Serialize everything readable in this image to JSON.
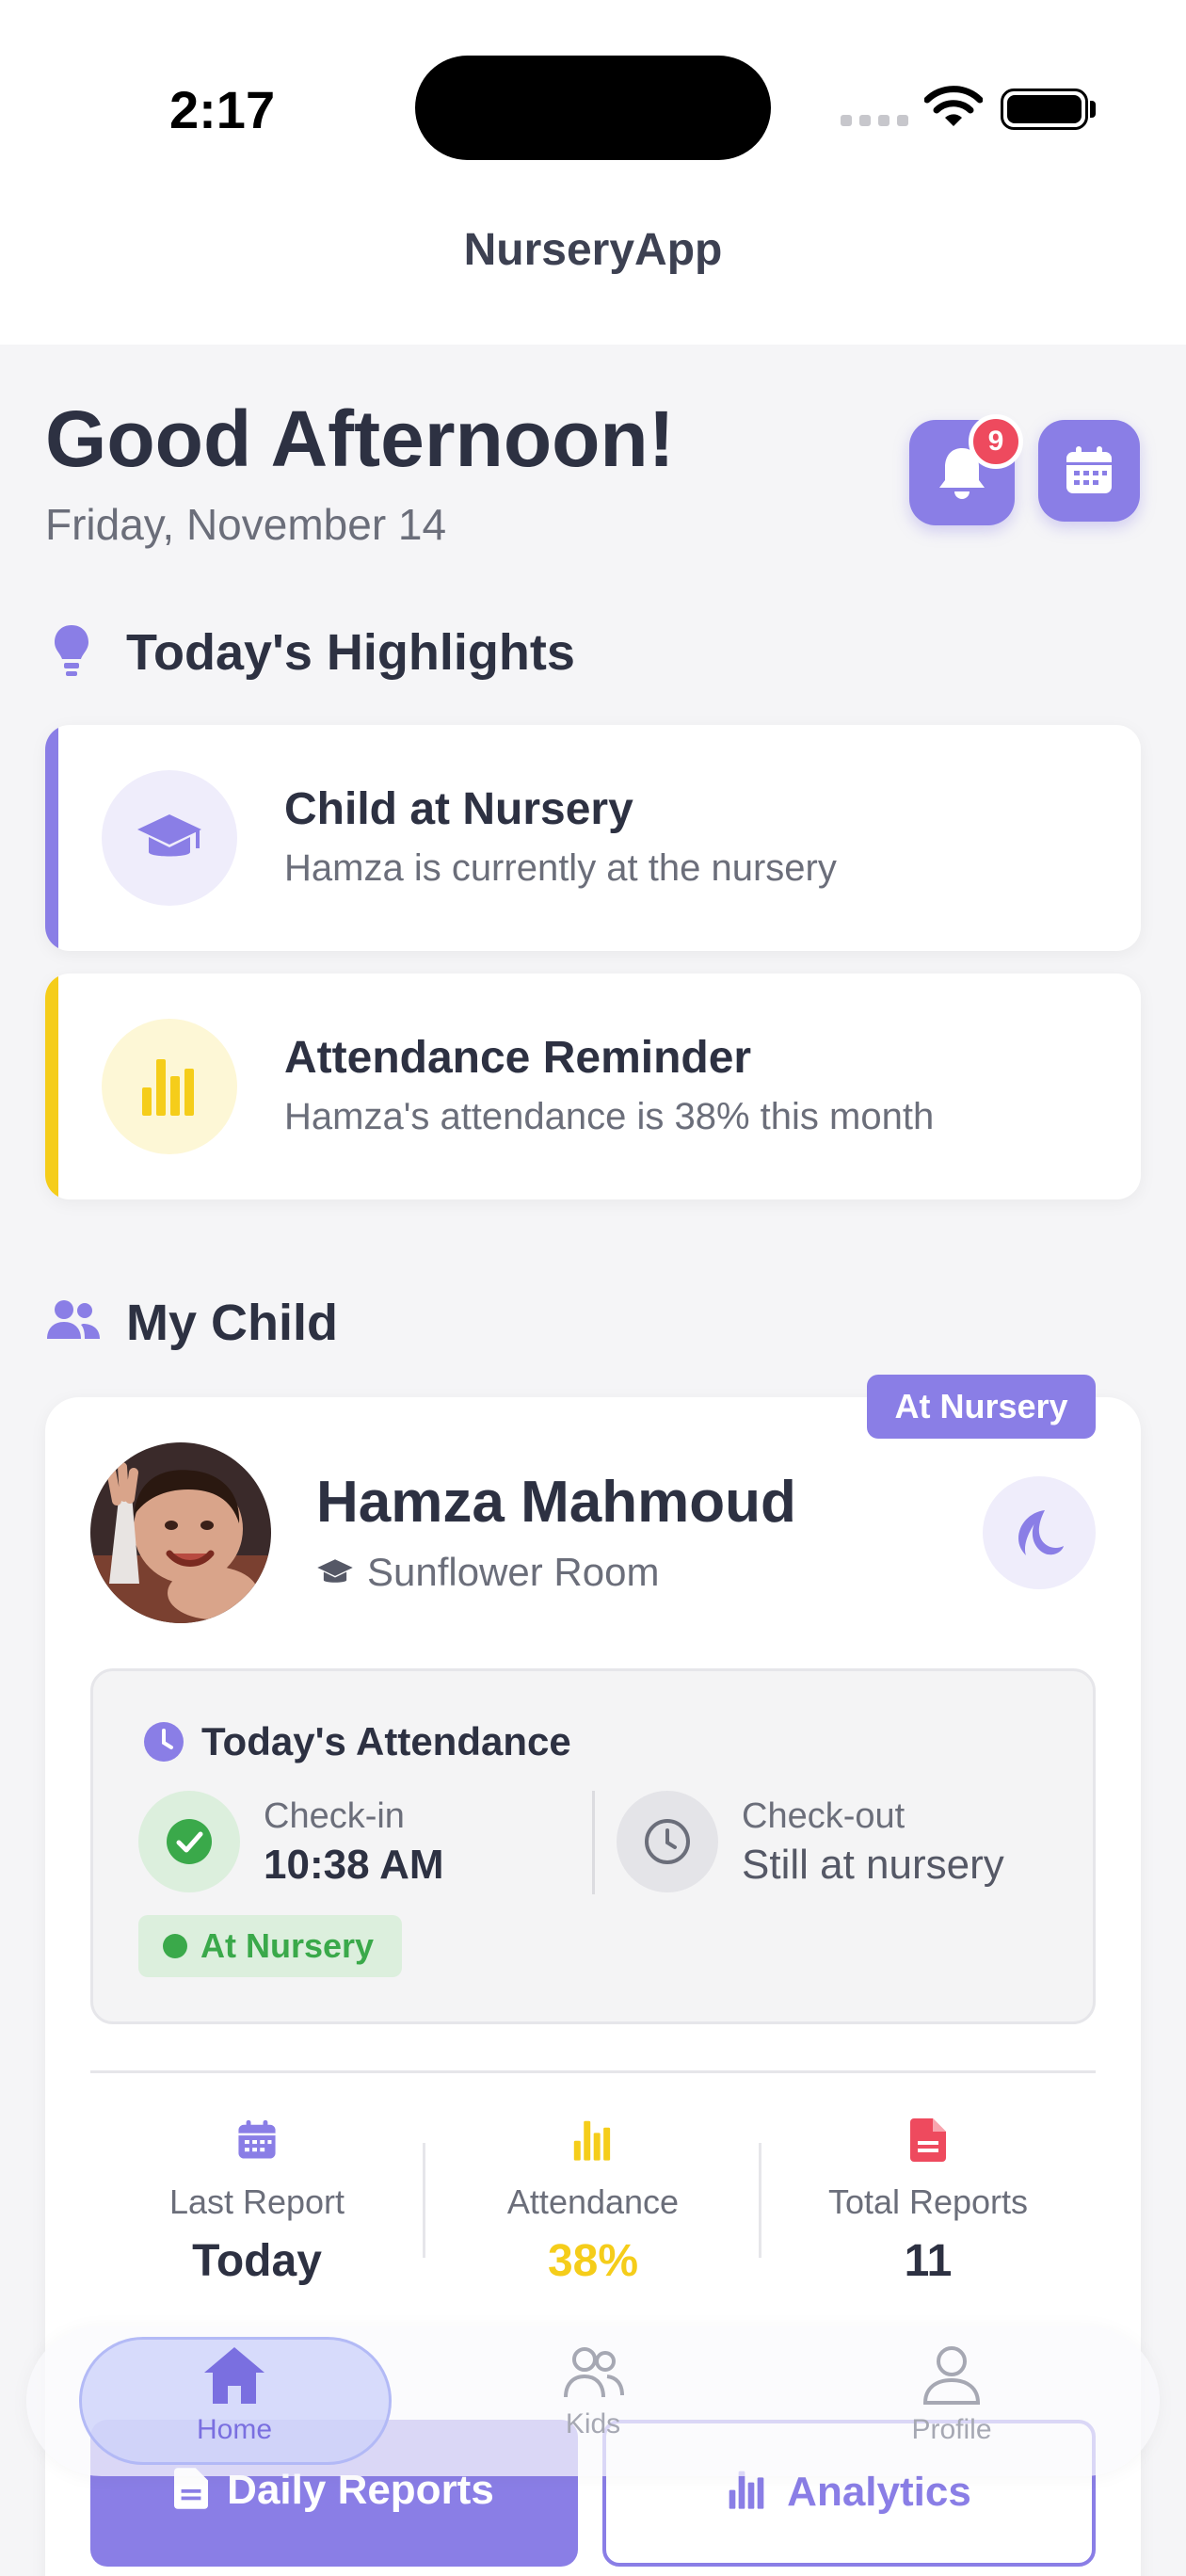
{
  "status_bar": {
    "time": "2:17"
  },
  "header": {
    "title": "NurseryApp"
  },
  "greeting": {
    "title": "Good Afternoon!",
    "date": "Friday, November 14",
    "notification_count": "9"
  },
  "highlights": {
    "title": "Today's Highlights",
    "items": [
      {
        "title": "Child at Nursery",
        "subtitle": "Hamza is currently at the nursery",
        "icon": "graduation-cap-icon",
        "accent": "#8a7ee6"
      },
      {
        "title": "Attendance Reminder",
        "subtitle": "Hamza's attendance is 38% this month",
        "icon": "bar-chart-icon",
        "accent": "#f5cd1a"
      }
    ]
  },
  "my_child": {
    "title": "My Child",
    "status_tag": "At Nursery",
    "name": "Hamza Mahmoud",
    "room": "Sunflower Room",
    "attendance": {
      "title": "Today's Attendance",
      "checkin_label": "Check-in",
      "checkin_value": "10:38 AM",
      "checkout_label": "Check-out",
      "checkout_value": "Still at nursery",
      "status": "At Nursery"
    },
    "stats": [
      {
        "label": "Last Report",
        "value": "Today",
        "icon": "calendar-icon"
      },
      {
        "label": "Attendance",
        "value": "38%",
        "icon": "bar-chart-icon"
      },
      {
        "label": "Total Reports",
        "value": "11",
        "icon": "document-icon"
      }
    ],
    "buttons": {
      "daily_reports": "Daily Reports",
      "analytics": "Analytics"
    }
  },
  "tabbar": {
    "tabs": [
      {
        "label": "Home",
        "icon": "home-icon",
        "active": true
      },
      {
        "label": "Kids",
        "icon": "people-icon",
        "active": false
      },
      {
        "label": "Profile",
        "icon": "person-icon",
        "active": false
      }
    ]
  },
  "colors": {
    "accent": "#8a7ee6",
    "warning": "#f5cd1a",
    "success": "#3aa94a",
    "danger": "#ee4a5e"
  }
}
